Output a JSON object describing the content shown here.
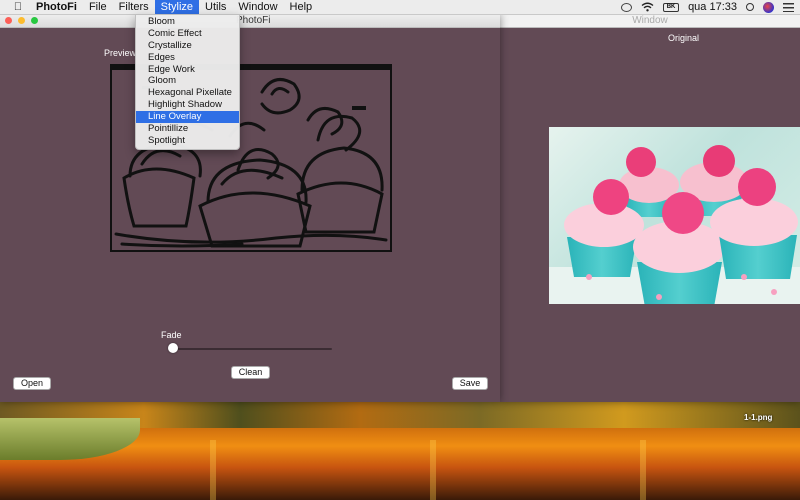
{
  "menubar": {
    "app_name": "PhotoFi",
    "menus": [
      "File",
      "Filters",
      "Stylize",
      "Utils",
      "Window",
      "Help"
    ],
    "active_menu": "Stylize",
    "battery_label": "BK",
    "clock": "qua 17:33",
    "icons": [
      "apple-icon",
      "cloud-icon",
      "wifi-icon",
      "battery-icon",
      "search-icon",
      "user-icon",
      "list-icon"
    ]
  },
  "stylize_menu": {
    "items": [
      "Bloom",
      "Comic Effect",
      "Crystallize",
      "Edges",
      "Edge Work",
      "Gloom",
      "Hexagonal Pixellate",
      "Highlight Shadow",
      "Line Overlay",
      "Pointillize",
      "Spotlight"
    ],
    "selected": "Line Overlay"
  },
  "main_window": {
    "title": "PhotoFi",
    "preview_label": "Preview",
    "fade_label": "Fade",
    "fade_value": 0,
    "clean_label": "Clean",
    "open_label": "Open",
    "save_label": "Save"
  },
  "original_window": {
    "title": "Window",
    "label": "Original"
  },
  "desktop": {
    "file_name": "1-1.png"
  },
  "colors": {
    "window_bg": "#624a55",
    "menu_highlight": "#2f6fe5"
  }
}
